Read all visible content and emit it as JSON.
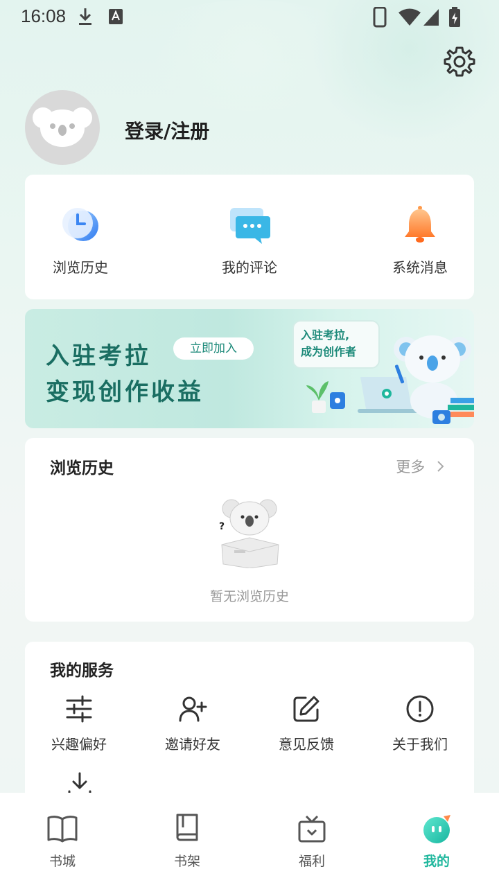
{
  "status_bar": {
    "time": "16:08"
  },
  "profile": {
    "login_label": "登录/注册"
  },
  "quick_actions": [
    {
      "label": "浏览历史",
      "icon": "clock-icon"
    },
    {
      "label": "我的评论",
      "icon": "chat-bubble-icon"
    },
    {
      "label": "系统消息",
      "icon": "bell-icon"
    }
  ],
  "banner": {
    "line1": "入驻考拉",
    "line2": "变现创作收益",
    "button": "立即加入",
    "bubble_line1": "入驻考拉,",
    "bubble_line2": "成为创作者"
  },
  "history": {
    "title": "浏览历史",
    "more": "更多",
    "empty": "暂无浏览历史"
  },
  "services": {
    "title": "我的服务",
    "items": [
      {
        "label": "兴趣偏好",
        "icon": "sliders-icon"
      },
      {
        "label": "邀请好友",
        "icon": "add-user-icon"
      },
      {
        "label": "意见反馈",
        "icon": "edit-icon"
      },
      {
        "label": "关于我们",
        "icon": "info-alert-icon"
      }
    ]
  },
  "tabbar": {
    "items": [
      {
        "label": "书城",
        "icon": "open-book-icon"
      },
      {
        "label": "书架",
        "icon": "book-icon"
      },
      {
        "label": "福利",
        "icon": "gift-icon"
      },
      {
        "label": "我的",
        "icon": "koala-face-icon"
      }
    ],
    "active_index": 3,
    "active_color": "#1fb79d"
  }
}
